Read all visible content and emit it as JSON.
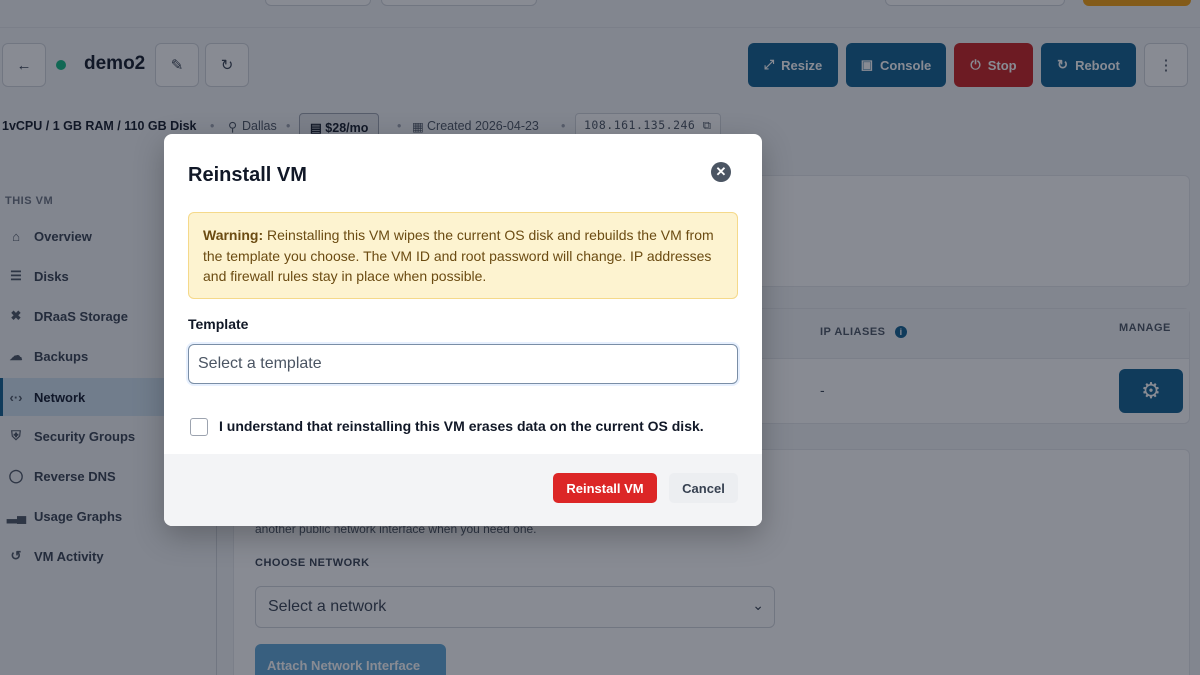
{
  "vm": {
    "name": "demo2",
    "spec": "1vCPU / 1 GB RAM / 110 GB Disk",
    "location": "Dallas",
    "price": "$28/mo",
    "created": "Created 2026-04-23",
    "ip": "108.161.135.246",
    "status_color": "#10b981"
  },
  "actions": {
    "resize": "Resize",
    "console": "Console",
    "stop": "Stop",
    "reboot": "Reboot"
  },
  "sidebar": {
    "heading": "THIS VM",
    "items": [
      {
        "label": "Overview",
        "icon": "home-icon"
      },
      {
        "label": "Disks",
        "icon": "list-icon"
      },
      {
        "label": "DRaaS Storage",
        "icon": "tools-icon"
      },
      {
        "label": "Backups",
        "icon": "cloud-upload-icon"
      },
      {
        "label": "Network",
        "icon": "code-icon",
        "active": true
      },
      {
        "label": "Security Groups",
        "icon": "shield-icon"
      },
      {
        "label": "Reverse DNS",
        "icon": "globe-icon"
      },
      {
        "label": "Usage Graphs",
        "icon": "bar-chart-icon"
      },
      {
        "label": "VM Activity",
        "icon": "history-icon"
      }
    ]
  },
  "network_table": {
    "col_ip_aliases": "IP ALIASES",
    "col_manage": "MANAGE",
    "row_ip_aliases": "-"
  },
  "attach": {
    "description": "another public network interface when you need one.",
    "choose_label": "CHOOSE NETWORK",
    "select_placeholder": "Select a network",
    "button": "Attach Network Interface"
  },
  "modal": {
    "title": "Reinstall VM",
    "warning_bold": "Warning:",
    "warning_text": " Reinstalling this VM wipes the current OS disk and rebuilds the VM from the template you choose. The VM ID and root password will change. IP addresses and firewall rules stay in place when possible.",
    "template_label": "Template",
    "template_placeholder": "Select a template",
    "template_value": "",
    "confirm_label": "I understand that reinstalling this VM erases data on the current OS disk.",
    "confirm_checked": false,
    "reinstall_button": "Reinstall VM",
    "cancel_button": "Cancel"
  },
  "colors": {
    "primary": "#0f5e8f",
    "danger": "#dc2626",
    "warning_bg": "#fdf3d0"
  }
}
